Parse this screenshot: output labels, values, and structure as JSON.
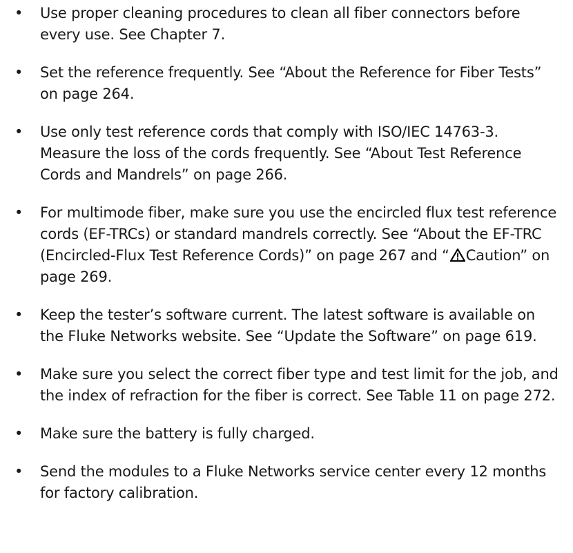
{
  "bullets": [
    {
      "text": "Use proper cleaning procedures to clean all fiber connectors before every use. See Chapter 7."
    },
    {
      "text": "Set the reference frequently. See “About the Reference for Fiber Tests” on page 264."
    },
    {
      "text": "Use only test reference cords that comply with ISO/IEC 14763-3. Measure the loss of the cords frequently. See “About Test Reference Cords and Mandrels” on page 266."
    },
    {
      "text_before_icon": "For multimode fiber, make sure you use the encircled flux test reference cords (EF-TRCs) or standard mandrels correctly. See “About the EF-TRC (Encircled-Flux Test Reference Cords)” on page 267 and “",
      "icon": "warning-triangle-icon",
      "text_after_icon": "Caution” on page 269."
    },
    {
      "text": "Keep the tester’s software current. The latest software is available on the Fluke Networks website. See “Update the Software” on page 619."
    },
    {
      "text": "Make sure you select the correct fiber type and test limit for the job, and the index of refraction for the fiber is correct. See Table 11 on page 272."
    },
    {
      "text": "Make sure the battery is fully charged."
    },
    {
      "text": "Send the modules to a Fluke Networks service center every 12 months for factory calibration."
    }
  ],
  "bullet_symbol": "•"
}
